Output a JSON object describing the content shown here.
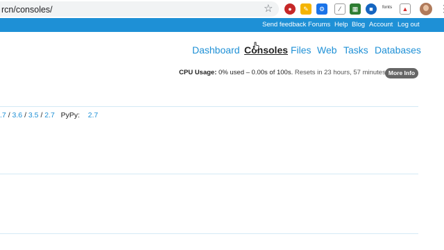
{
  "browser": {
    "url": "rcn/consoles/",
    "fonts_ext_label": "fonts"
  },
  "topbar": {
    "links": [
      "Send feedback",
      "Forums",
      "Help",
      "Blog",
      "Account",
      "Log out"
    ]
  },
  "nav": {
    "items": [
      "Dashboard",
      "Consoles",
      "Files",
      "Web",
      "Tasks",
      "Databases"
    ],
    "active": "Consoles"
  },
  "cpu": {
    "label": "CPU Usage:",
    "value": "0% used – 0.00s of 100s.",
    "reset": "Resets in 23 hours, 57 minutes",
    "more_info": "More Info"
  },
  "versions": {
    "python": [
      ".7",
      "3.6",
      "3.5",
      "2.7"
    ],
    "sep": "/",
    "pypy_label": "PyPy:",
    "pypy": "2.7"
  },
  "colors": {
    "brand": "#1e90d6",
    "divider": "#d3e9f5"
  }
}
